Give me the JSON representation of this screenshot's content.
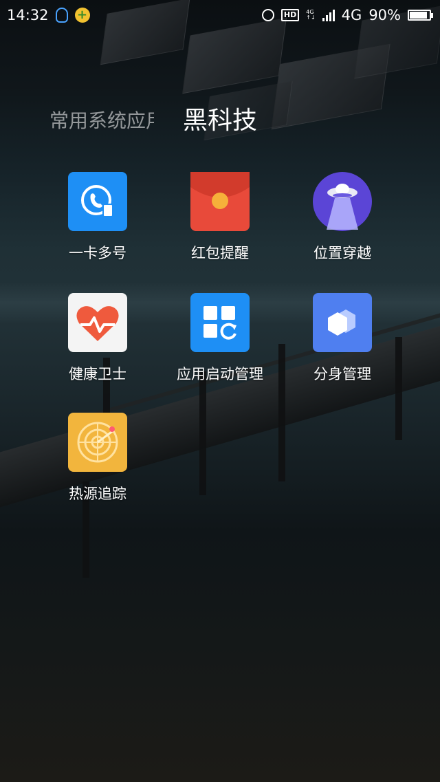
{
  "status_bar": {
    "time": "14:32",
    "hd": "HD",
    "net_small": "4G",
    "network": "4G",
    "battery_percent": "90%",
    "battery_level": 0.9
  },
  "folder": {
    "previous_tab": "常用系统应用",
    "current_tab": "黑科技"
  },
  "apps": [
    {
      "label": "一卡多号",
      "icon": "phone-card-icon",
      "color": "#1e8ff5"
    },
    {
      "label": "红包提醒",
      "icon": "red-envelope-icon",
      "color": "#e84a3a"
    },
    {
      "label": "位置穿越",
      "icon": "ufo-icon",
      "color": "#5b45d6"
    },
    {
      "label": "健康卫士",
      "icon": "heart-icon",
      "color": "#f4f4f4"
    },
    {
      "label": "应用启动管理",
      "icon": "app-launch-icon",
      "color": "#1e8ff5"
    },
    {
      "label": "分身管理",
      "icon": "hexagon-clone-icon",
      "color": "#4f7ff0"
    },
    {
      "label": "热源追踪",
      "icon": "radar-icon",
      "color": "#f2b53d"
    }
  ]
}
